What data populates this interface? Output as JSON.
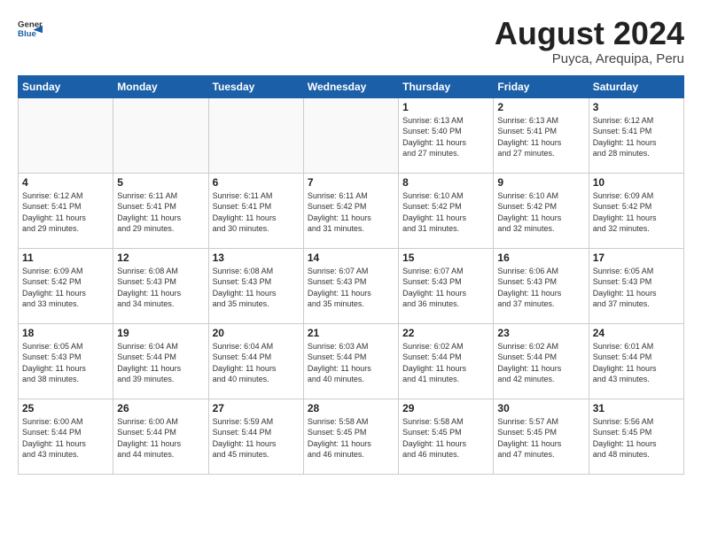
{
  "logo": {
    "general": "General",
    "blue": "Blue"
  },
  "header": {
    "title": "August 2024",
    "subtitle": "Puyca, Arequipa, Peru"
  },
  "weekdays": [
    "Sunday",
    "Monday",
    "Tuesday",
    "Wednesday",
    "Thursday",
    "Friday",
    "Saturday"
  ],
  "weeks": [
    [
      {
        "day": "",
        "info": ""
      },
      {
        "day": "",
        "info": ""
      },
      {
        "day": "",
        "info": ""
      },
      {
        "day": "",
        "info": ""
      },
      {
        "day": "1",
        "info": "Sunrise: 6:13 AM\nSunset: 5:40 PM\nDaylight: 11 hours\nand 27 minutes."
      },
      {
        "day": "2",
        "info": "Sunrise: 6:13 AM\nSunset: 5:41 PM\nDaylight: 11 hours\nand 27 minutes."
      },
      {
        "day": "3",
        "info": "Sunrise: 6:12 AM\nSunset: 5:41 PM\nDaylight: 11 hours\nand 28 minutes."
      }
    ],
    [
      {
        "day": "4",
        "info": "Sunrise: 6:12 AM\nSunset: 5:41 PM\nDaylight: 11 hours\nand 29 minutes."
      },
      {
        "day": "5",
        "info": "Sunrise: 6:11 AM\nSunset: 5:41 PM\nDaylight: 11 hours\nand 29 minutes."
      },
      {
        "day": "6",
        "info": "Sunrise: 6:11 AM\nSunset: 5:41 PM\nDaylight: 11 hours\nand 30 minutes."
      },
      {
        "day": "7",
        "info": "Sunrise: 6:11 AM\nSunset: 5:42 PM\nDaylight: 11 hours\nand 31 minutes."
      },
      {
        "day": "8",
        "info": "Sunrise: 6:10 AM\nSunset: 5:42 PM\nDaylight: 11 hours\nand 31 minutes."
      },
      {
        "day": "9",
        "info": "Sunrise: 6:10 AM\nSunset: 5:42 PM\nDaylight: 11 hours\nand 32 minutes."
      },
      {
        "day": "10",
        "info": "Sunrise: 6:09 AM\nSunset: 5:42 PM\nDaylight: 11 hours\nand 32 minutes."
      }
    ],
    [
      {
        "day": "11",
        "info": "Sunrise: 6:09 AM\nSunset: 5:42 PM\nDaylight: 11 hours\nand 33 minutes."
      },
      {
        "day": "12",
        "info": "Sunrise: 6:08 AM\nSunset: 5:43 PM\nDaylight: 11 hours\nand 34 minutes."
      },
      {
        "day": "13",
        "info": "Sunrise: 6:08 AM\nSunset: 5:43 PM\nDaylight: 11 hours\nand 35 minutes."
      },
      {
        "day": "14",
        "info": "Sunrise: 6:07 AM\nSunset: 5:43 PM\nDaylight: 11 hours\nand 35 minutes."
      },
      {
        "day": "15",
        "info": "Sunrise: 6:07 AM\nSunset: 5:43 PM\nDaylight: 11 hours\nand 36 minutes."
      },
      {
        "day": "16",
        "info": "Sunrise: 6:06 AM\nSunset: 5:43 PM\nDaylight: 11 hours\nand 37 minutes."
      },
      {
        "day": "17",
        "info": "Sunrise: 6:05 AM\nSunset: 5:43 PM\nDaylight: 11 hours\nand 37 minutes."
      }
    ],
    [
      {
        "day": "18",
        "info": "Sunrise: 6:05 AM\nSunset: 5:43 PM\nDaylight: 11 hours\nand 38 minutes."
      },
      {
        "day": "19",
        "info": "Sunrise: 6:04 AM\nSunset: 5:44 PM\nDaylight: 11 hours\nand 39 minutes."
      },
      {
        "day": "20",
        "info": "Sunrise: 6:04 AM\nSunset: 5:44 PM\nDaylight: 11 hours\nand 40 minutes."
      },
      {
        "day": "21",
        "info": "Sunrise: 6:03 AM\nSunset: 5:44 PM\nDaylight: 11 hours\nand 40 minutes."
      },
      {
        "day": "22",
        "info": "Sunrise: 6:02 AM\nSunset: 5:44 PM\nDaylight: 11 hours\nand 41 minutes."
      },
      {
        "day": "23",
        "info": "Sunrise: 6:02 AM\nSunset: 5:44 PM\nDaylight: 11 hours\nand 42 minutes."
      },
      {
        "day": "24",
        "info": "Sunrise: 6:01 AM\nSunset: 5:44 PM\nDaylight: 11 hours\nand 43 minutes."
      }
    ],
    [
      {
        "day": "25",
        "info": "Sunrise: 6:00 AM\nSunset: 5:44 PM\nDaylight: 11 hours\nand 43 minutes."
      },
      {
        "day": "26",
        "info": "Sunrise: 6:00 AM\nSunset: 5:44 PM\nDaylight: 11 hours\nand 44 minutes."
      },
      {
        "day": "27",
        "info": "Sunrise: 5:59 AM\nSunset: 5:44 PM\nDaylight: 11 hours\nand 45 minutes."
      },
      {
        "day": "28",
        "info": "Sunrise: 5:58 AM\nSunset: 5:45 PM\nDaylight: 11 hours\nand 46 minutes."
      },
      {
        "day": "29",
        "info": "Sunrise: 5:58 AM\nSunset: 5:45 PM\nDaylight: 11 hours\nand 46 minutes."
      },
      {
        "day": "30",
        "info": "Sunrise: 5:57 AM\nSunset: 5:45 PM\nDaylight: 11 hours\nand 47 minutes."
      },
      {
        "day": "31",
        "info": "Sunrise: 5:56 AM\nSunset: 5:45 PM\nDaylight: 11 hours\nand 48 minutes."
      }
    ]
  ]
}
